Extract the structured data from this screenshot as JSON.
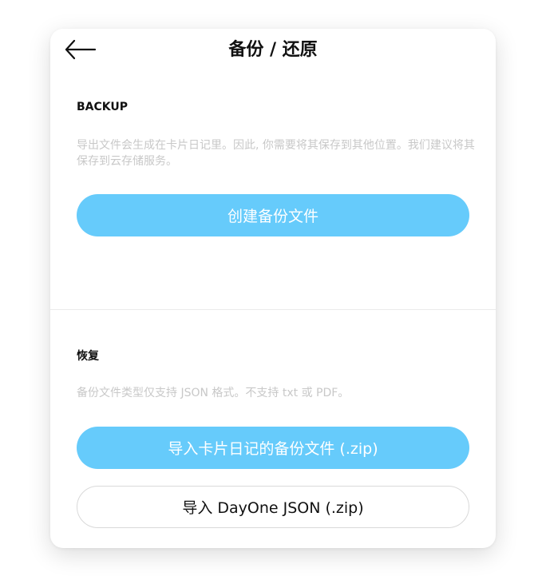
{
  "header": {
    "title": "备份 / 还原",
    "back_icon": "arrow-left-icon"
  },
  "backup": {
    "heading": "BACKUP",
    "description": "导出文件会生成在卡片日记里。因此, 你需要将其保存到其他位置。我们建议将其保存到云存储服务。",
    "create_button": "创建备份文件"
  },
  "restore": {
    "heading": "恢复",
    "description": "备份文件类型仅支持 JSON 格式。不支持 txt 或 PDF。",
    "import_backup_button": "导入卡片日记的备份文件 (.zip)",
    "import_dayone_button": "导入 DayOne JSON (.zip)"
  },
  "colors": {
    "accent": "#66cbfb",
    "description_text": "#c8c8c8"
  }
}
